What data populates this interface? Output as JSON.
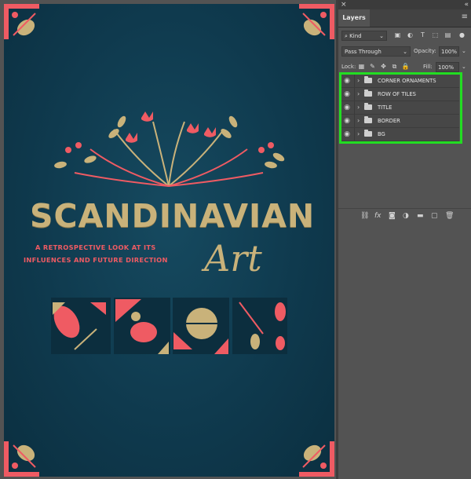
{
  "panel": {
    "close": "×",
    "collapse": "«",
    "tab": "Layers",
    "menu": "≡",
    "filter_kind": "Kind",
    "blend_mode": "Pass Through",
    "opacity_label": "Opacity:",
    "opacity_value": "100%",
    "lock_label": "Lock:",
    "fill_label": "Fill:",
    "fill_value": "100%",
    "layers": [
      {
        "name": "CORNER ORNAMENTS"
      },
      {
        "name": "ROW OF TILES"
      },
      {
        "name": "TITLE"
      },
      {
        "name": "BORDER"
      },
      {
        "name": "BG"
      }
    ],
    "bottom_icons": [
      "link-icon",
      "fx-icon",
      "mask-icon",
      "adjustment-icon",
      "group-icon",
      "new-layer-icon",
      "trash-icon"
    ],
    "highlight_color": "#22dd22"
  },
  "poster": {
    "title": "SCANDINAVIAN",
    "subtitle_line1": "A RETROSPECTIVE LOOK AT ITS",
    "subtitle_line2": "INFLUENCES AND FUTURE DIRECTION",
    "art": "Art",
    "colors": {
      "background": "#0e3a4e",
      "gold": "#c9b27a",
      "coral": "#ef5b63"
    }
  }
}
